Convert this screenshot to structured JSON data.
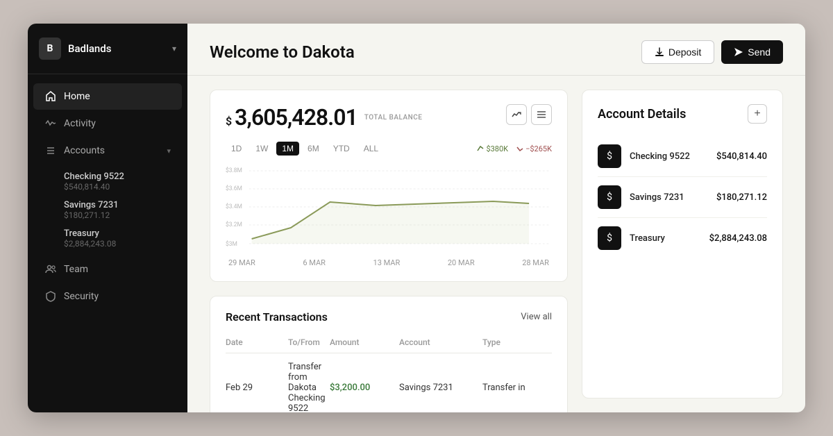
{
  "app": {
    "company_logo": "B",
    "company_name": "Badlands",
    "title": "Welcome to Dakota"
  },
  "sidebar": {
    "nav_items": [
      {
        "id": "home",
        "label": "Home",
        "icon": "home",
        "active": true
      },
      {
        "id": "activity",
        "label": "Activity",
        "icon": "activity",
        "active": false
      },
      {
        "id": "accounts",
        "label": "Accounts",
        "icon": "list",
        "active": false,
        "has_chevron": true
      },
      {
        "id": "team",
        "label": "Team",
        "icon": "team",
        "active": false
      },
      {
        "id": "security",
        "label": "Security",
        "icon": "shield",
        "active": false
      }
    ],
    "sub_accounts": [
      {
        "name": "Checking 9522",
        "amount": "$540,814.40"
      },
      {
        "name": "Savings 7231",
        "amount": "$180,271.12"
      },
      {
        "name": "Treasury",
        "amount": "$2,884,243.08"
      }
    ]
  },
  "header": {
    "deposit_label": "Deposit",
    "send_label": "Send"
  },
  "balance": {
    "dollar_sign": "$",
    "amount": "3,605,428.01",
    "label": "TOTAL BALANCE"
  },
  "chart": {
    "filters": [
      "1D",
      "1W",
      "1M",
      "6M",
      "YTD",
      "ALL"
    ],
    "active_filter": "1M",
    "legend_up": "$380K",
    "legend_down": "−$265K",
    "y_labels": [
      "$3.8M",
      "$3.6M",
      "$3.4M",
      "$3.2M",
      "$3M"
    ],
    "x_labels": [
      "29 MAR",
      "6 MAR",
      "13 MAR",
      "20 MAR",
      "28 MAR"
    ]
  },
  "transactions": {
    "title": "Recent Transactions",
    "view_all": "View all",
    "columns": [
      "Date",
      "To/From",
      "Amount",
      "Account",
      "Type"
    ],
    "rows": [
      {
        "date": "Feb 29",
        "to_from": "Transfer from Dakota Checking 9522",
        "amount": "$3,200.00",
        "amount_type": "positive",
        "account": "Savings 7231",
        "type": "Transfer in"
      }
    ]
  },
  "account_details": {
    "title": "Account Details",
    "accounts": [
      {
        "name": "Checking 9522",
        "balance": "$540,814.40"
      },
      {
        "name": "Savings 7231",
        "balance": "$180,271.12"
      },
      {
        "name": "Treasury",
        "balance": "$2,884,243.08"
      }
    ]
  }
}
